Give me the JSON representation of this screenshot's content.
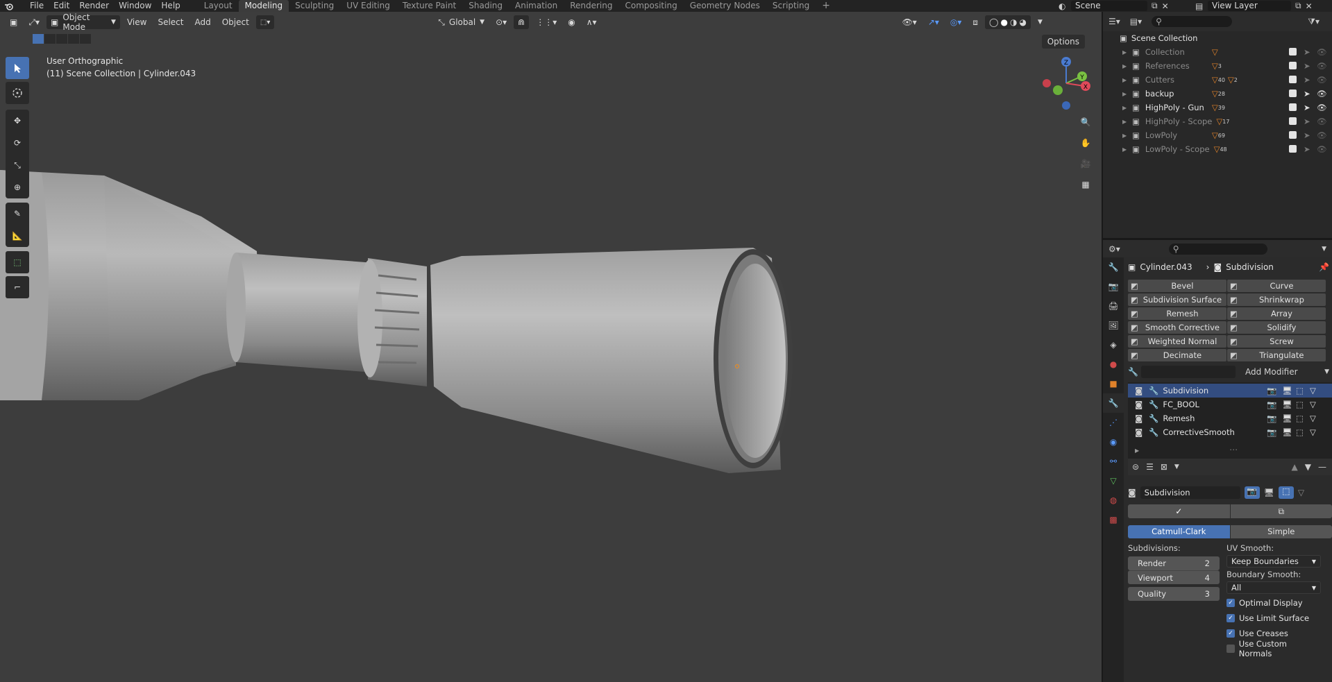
{
  "topbar": {
    "menus": [
      "File",
      "Edit",
      "Render",
      "Window",
      "Help"
    ],
    "workspaces": [
      "Layout",
      "Modeling",
      "Sculpting",
      "UV Editing",
      "Texture Paint",
      "Shading",
      "Animation",
      "Rendering",
      "Compositing",
      "Geometry Nodes",
      "Scripting"
    ],
    "active_workspace": "Modeling",
    "add_tab": "+",
    "scene": "Scene",
    "view_layer": "View Layer"
  },
  "viewport": {
    "mode": "Object Mode",
    "menus": [
      "View",
      "Select",
      "Add",
      "Object"
    ],
    "orientation": "Global",
    "options": "Options",
    "view_name": "User Orthographic",
    "view_context": "(11) Scene Collection | Cylinder.043",
    "gizmo": {
      "z": "Z",
      "y": "Y",
      "x": "X"
    },
    "background_color": "#3d3d3d"
  },
  "outliner": {
    "root": "Scene Collection",
    "collections": [
      {
        "name": "Collection",
        "count": "",
        "bright": false
      },
      {
        "name": "References",
        "count": "3",
        "bright": false
      },
      {
        "name": "Cutters",
        "count": "40",
        "count2": "2",
        "bright": false
      },
      {
        "name": "backup",
        "count": "28",
        "bright": true
      },
      {
        "name": "HighPoly - Gun",
        "count": "39",
        "bright": true
      },
      {
        "name": "HighPoly - Scope",
        "count": "17",
        "bright": false
      },
      {
        "name": "LowPoly",
        "count": "69",
        "bright": false
      },
      {
        "name": "LowPoly - Scope",
        "count": "48",
        "bright": false
      }
    ]
  },
  "properties": {
    "object": "Cylinder.043",
    "modifier": "Subdivision",
    "modifier_buttons": [
      [
        "Bevel",
        "Curve"
      ],
      [
        "Subdivision Surface",
        "Shrinkwrap"
      ],
      [
        "Remesh",
        "Array"
      ],
      [
        "Smooth Corrective",
        "Solidify"
      ],
      [
        "Weighted Normal",
        "Screw"
      ],
      [
        "Decimate",
        "Triangulate"
      ]
    ],
    "add_modifier": "Add Modifier",
    "stack": [
      "Subdivision",
      "FC_BOOL",
      "Remesh",
      "CorrectiveSmooth"
    ],
    "active_name": "Subdivision",
    "apply_icon": "✓",
    "type_options": [
      "Catmull-Clark",
      "Simple"
    ],
    "subdivisions_label": "Subdivisions:",
    "render_label": "Render",
    "render_val": "2",
    "viewport_label": "Viewport",
    "viewport_val": "4",
    "quality_label": "Quality",
    "quality_val": "3",
    "uv_smooth_label": "UV Smooth:",
    "uv_smooth": "Keep Boundaries",
    "boundary_smooth_label": "Boundary Smooth:",
    "boundary_smooth": "All",
    "checks": [
      {
        "label": "Optimal Display",
        "on": true
      },
      {
        "label": "Use Limit Surface",
        "on": true
      },
      {
        "label": "Use Creases",
        "on": true
      },
      {
        "label": "Use Custom Normals",
        "on": false
      }
    ],
    "accent": "#4772b3"
  }
}
